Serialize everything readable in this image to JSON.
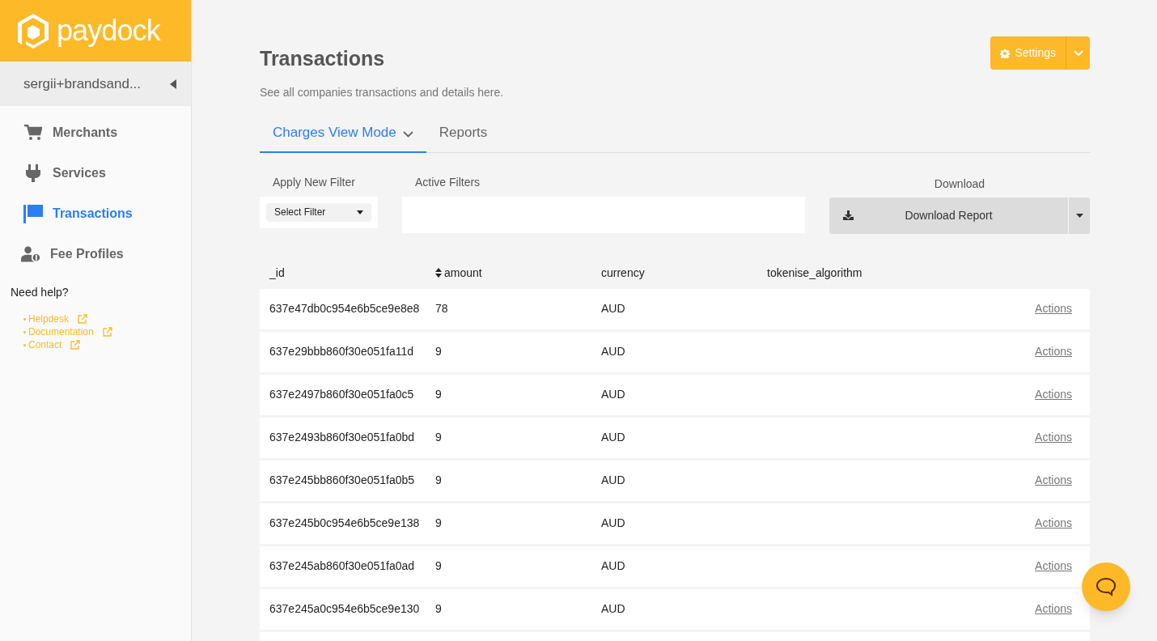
{
  "brand": {
    "name": "paydock"
  },
  "account": {
    "name": "sergii+brandsand..."
  },
  "nav": [
    {
      "kind": "cart",
      "label": "Merchants",
      "selected": false
    },
    {
      "kind": "plug",
      "label": "Services",
      "selected": false
    },
    {
      "kind": "flag",
      "label": "Transactions",
      "selected": true
    },
    {
      "kind": "user",
      "label": "Fee Profiles",
      "selected": false
    }
  ],
  "help": {
    "title": "Need help?",
    "links": [
      "Helpdesk",
      "Documentation",
      "Contact"
    ]
  },
  "page": {
    "title": "Transactions",
    "subtitle": "See all companies transactions and details here.",
    "settings_button": "Settings"
  },
  "tabs": [
    {
      "label": "Charges View Mode",
      "selected": true,
      "dropdown": true
    },
    {
      "label": "Reports",
      "selected": false,
      "dropdown": false
    }
  ],
  "filters": {
    "apply_label": "Apply New Filter",
    "select_value": "Select Filter",
    "active_label": "Active Filters"
  },
  "download": {
    "label": "Download",
    "button": "Download Report"
  },
  "table": {
    "columns": [
      {
        "label": "_id",
        "sortable": false
      },
      {
        "label": "amount",
        "sortable": true
      },
      {
        "label": "currency",
        "sortable": false
      },
      {
        "label": "tokenise_algorithm",
        "sortable": false
      }
    ],
    "rows": [
      {
        "cells": [
          "637e47db0c954e6b5ce9e8e8",
          "78",
          "AUD",
          ""
        ],
        "action": "Actions"
      },
      {
        "cells": [
          "637e29bbb860f30e051fa11d",
          "9",
          "AUD",
          ""
        ],
        "action": "Actions"
      },
      {
        "cells": [
          "637e2497b860f30e051fa0c5",
          "9",
          "AUD",
          ""
        ],
        "action": "Actions"
      },
      {
        "cells": [
          "637e2493b860f30e051fa0bd",
          "9",
          "AUD",
          ""
        ],
        "action": "Actions"
      },
      {
        "cells": [
          "637e245bb860f30e051fa0b5",
          "9",
          "AUD",
          ""
        ],
        "action": "Actions"
      },
      {
        "cells": [
          "637e245b0c954e6b5ce9e138",
          "9",
          "AUD",
          ""
        ],
        "action": "Actions"
      },
      {
        "cells": [
          "637e245ab860f30e051fa0ad",
          "9",
          "AUD",
          ""
        ],
        "action": "Actions"
      },
      {
        "cells": [
          "637e245a0c954e6b5ce9e130",
          "9",
          "AUD",
          ""
        ],
        "action": "Actions"
      }
    ]
  }
}
